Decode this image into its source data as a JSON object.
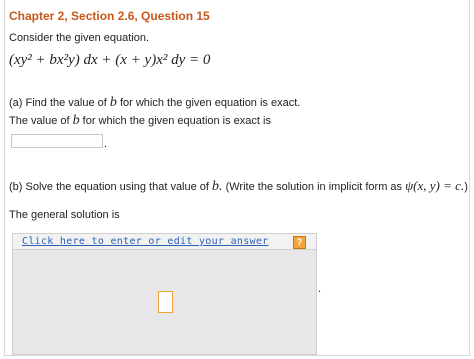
{
  "header": {
    "title": "Chapter 2, Section 2.6, Question 15"
  },
  "intro": "Consider the given equation.",
  "equation": "(xy² + bx²y) dx + (x + y)x² dy = 0",
  "part_a": {
    "prompt_pre": "(a) Find the value of ",
    "prompt_var": "b",
    "prompt_post": " for which the given equation is exact.",
    "answer_label_pre": "The value of ",
    "answer_label_var": "b",
    "answer_label_post": " for which the given equation is exact is",
    "answer_value": "",
    "trailing": "."
  },
  "part_b": {
    "prompt_pre": "(b) Solve the equation using that value of ",
    "prompt_var": "b.",
    "prompt_mid": " (Write the solution in implicit form as ",
    "prompt_math": "ψ(x, y) = c.",
    "prompt_post": ")",
    "answer_label": "The general solution is",
    "editor_link": "Click here to enter or edit your answer",
    "help_label": "?",
    "trailing": "."
  },
  "colors": {
    "title": "#c8581a",
    "link": "#2a62b8",
    "help": "#f2a33a"
  }
}
